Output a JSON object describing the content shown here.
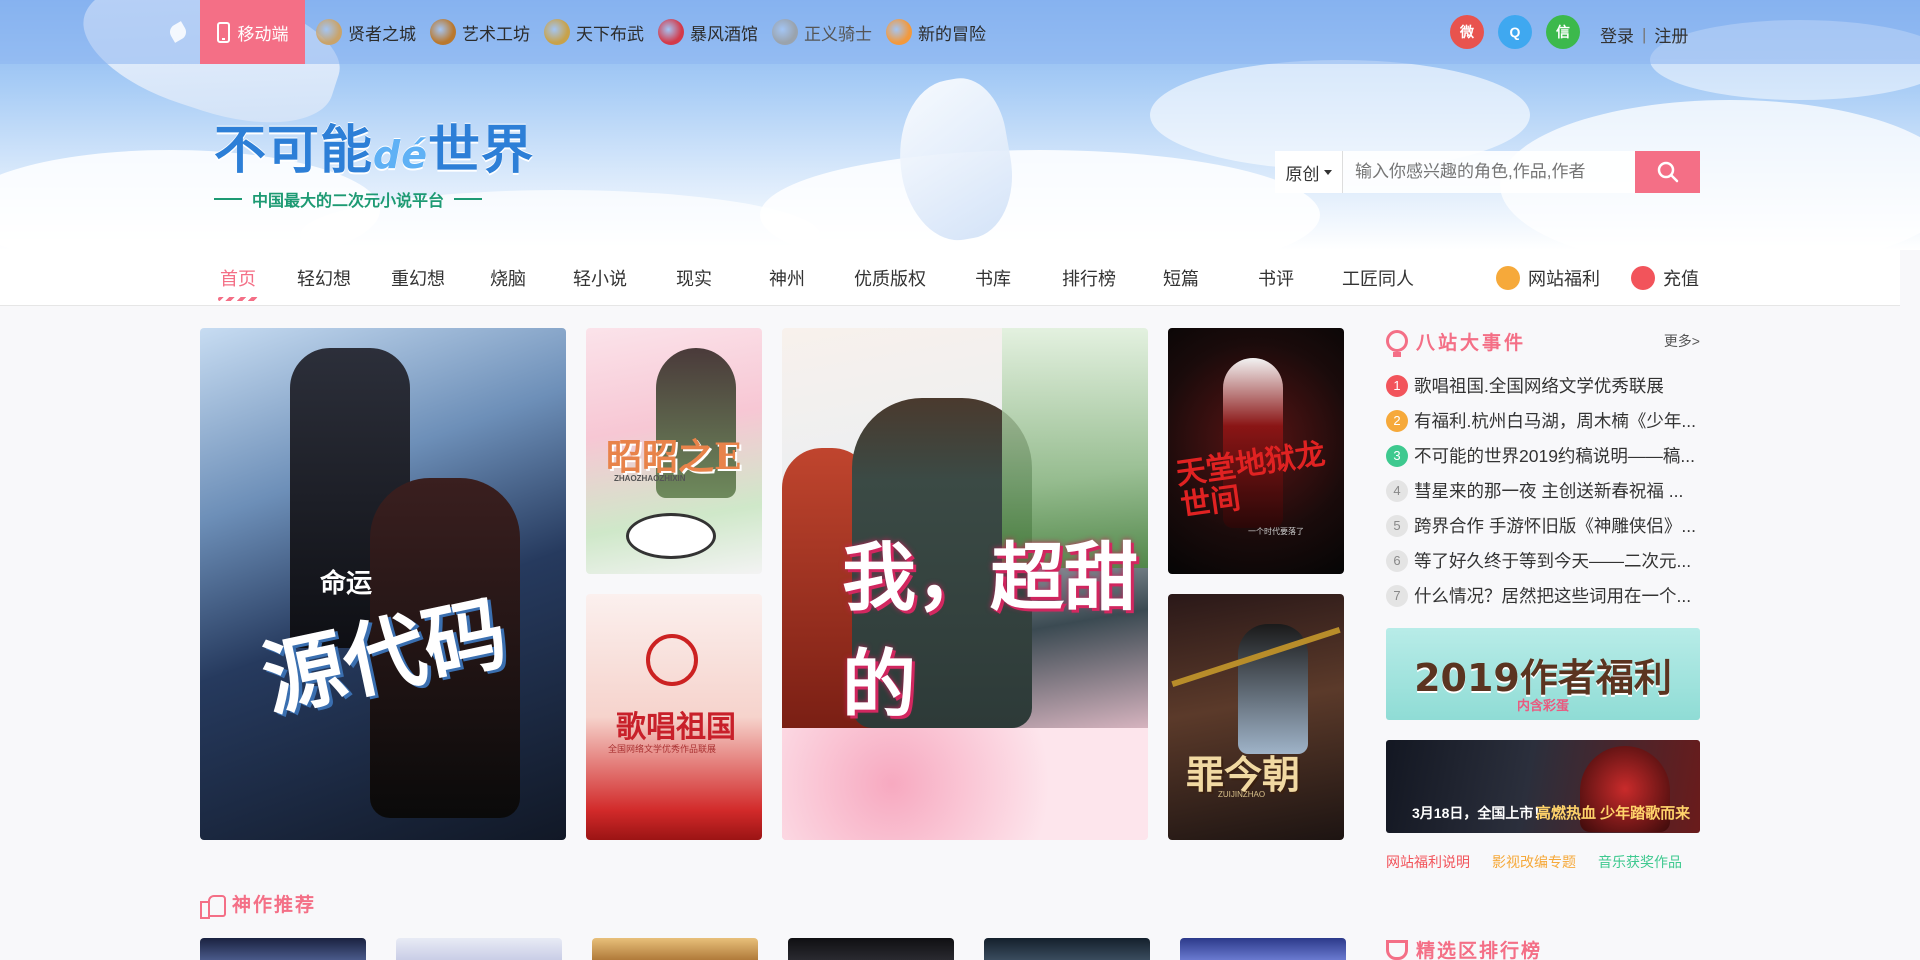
{
  "topbar": {
    "mobile_label": "移动端",
    "links": [
      {
        "label": "贤者之城",
        "icon": "scroll-icon",
        "color": "#c9a36a"
      },
      {
        "label": "艺术工坊",
        "icon": "palette-icon",
        "color": "#b9782e"
      },
      {
        "label": "天下布武",
        "icon": "harp-icon",
        "color": "#c8a24a"
      },
      {
        "label": "暴风酒馆",
        "icon": "bottle-icon",
        "color": "#d33a4a"
      },
      {
        "label": "正义骑士",
        "icon": "sword-icon",
        "color": "#9aa3ad"
      },
      {
        "label": "新的冒险",
        "icon": "fox-icon",
        "color": "#f2993d"
      }
    ],
    "social": [
      {
        "name": "weibo-icon",
        "glyph": "微"
      },
      {
        "name": "qq-icon",
        "glyph": "Q"
      },
      {
        "name": "wechat-icon",
        "glyph": "信"
      }
    ],
    "login": "登录",
    "separator": "|",
    "register": "注册"
  },
  "brand": {
    "logo_part1": "不可能",
    "logo_de": "dé",
    "logo_part2": "世界",
    "tagline": "中国最大的二次元小说平台"
  },
  "search": {
    "select_value": "原创",
    "placeholder": "输入你感兴趣的角色,作品,作者"
  },
  "nav": {
    "items": [
      "首页",
      "轻幻想",
      "重幻想",
      "烧脑",
      "轻小说",
      "现实",
      "神州",
      "优质版权",
      "书库",
      "排行榜",
      "短篇",
      "书评",
      "工匠同人"
    ],
    "active_index": 0,
    "welfare": "网站福利",
    "recharge": "充值"
  },
  "covers": [
    {
      "title_small": "命运",
      "title": "源代码"
    },
    {
      "title": "昭昭之E",
      "subtitle": "ZHAOZHAOZHIXIN"
    },
    {
      "title": "歌唱祖国",
      "subtitle": "全国网络文学优秀作品联展"
    },
    {
      "title": "我，超甜的"
    },
    {
      "title": "天堂地狱龙世间",
      "subtitle": "一个时代要落了"
    },
    {
      "title": "罪今朝",
      "subtitle": "ZUIJINZHAO"
    }
  ],
  "events": {
    "title": "八站大事件",
    "more": "更多>",
    "items": [
      {
        "num": "1",
        "text": "歌唱祖国.全国网络文学优秀联展"
      },
      {
        "num": "2",
        "text": "有福利.杭州白马湖，周木楠《少年..."
      },
      {
        "num": "3",
        "text": "不可能的世界2019约稿说明——稿..."
      },
      {
        "num": "4",
        "text": "彗星来的那一夜 主创送新春祝福 ..."
      },
      {
        "num": "5",
        "text": "跨界合作 手游怀旧版《神雕侠侣》..."
      },
      {
        "num": "6",
        "text": "等了好久终于等到今天——二次元..."
      },
      {
        "num": "7",
        "text": "什么情况？居然把这些词用在一个..."
      }
    ]
  },
  "promos": {
    "promo1_title": "2019作者福利",
    "promo1_sub": "内含彩蛋",
    "promo2_date": "3月18日，全国上市！",
    "promo2_slogan": "高燃热血 少年踏歌而来"
  },
  "bottom_links": [
    {
      "label": "网站福利说明",
      "color": "#f2545b"
    },
    {
      "label": "影视改编专题",
      "color": "#f6a93a"
    },
    {
      "label": "音乐获奖作品",
      "color": "#3ec98f"
    }
  ],
  "sections": {
    "recommend": "神作推荐",
    "ranking": "精选区排行榜"
  },
  "colors": {
    "accent": "#f46f86",
    "brand_blue": "#2d7fd7"
  }
}
